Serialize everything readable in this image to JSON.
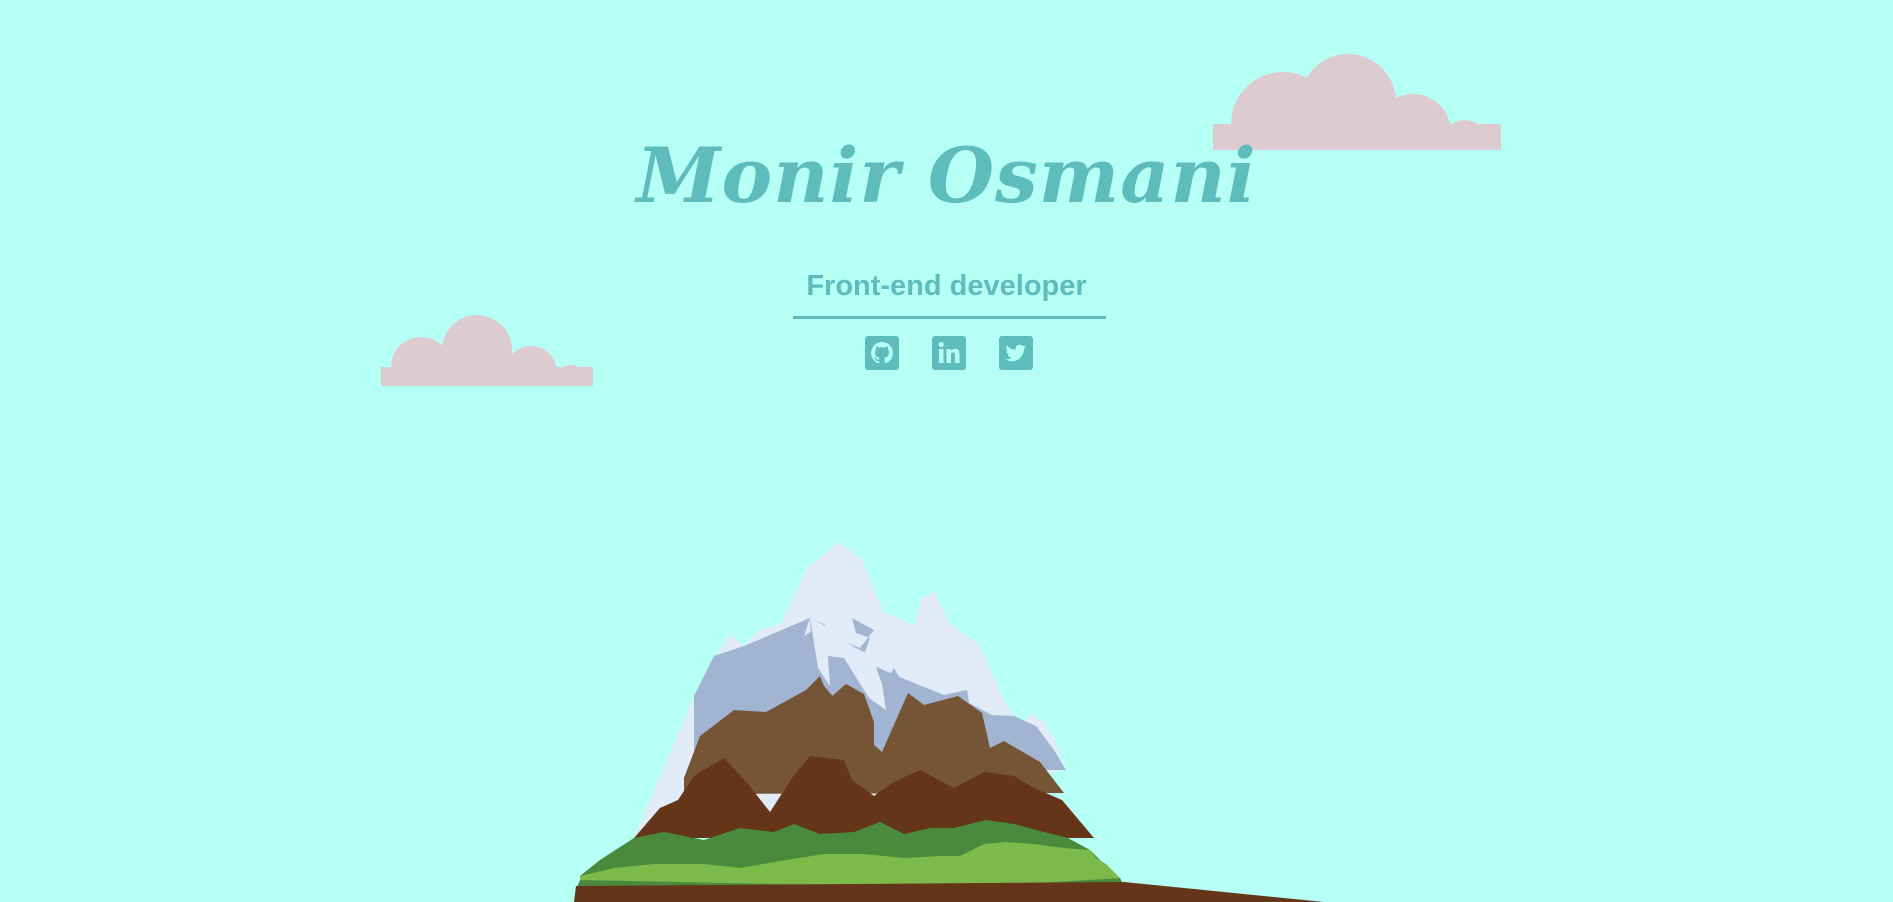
{
  "hero": {
    "name": "Monir Osmani",
    "role": "Front-end developer"
  },
  "socials": [
    {
      "icon": "github-icon",
      "label": "GitHub"
    },
    {
      "icon": "linkedin-icon",
      "label": "LinkedIn"
    },
    {
      "icon": "twitter-icon",
      "label": "Twitter"
    }
  ],
  "colors": {
    "background": "#b6fff4",
    "accent": "#5fbcbc",
    "cloud": "#dccbd1",
    "snow": "#e1ecf8",
    "snow_shadow": "#a1b4d1",
    "rock_light": "#765537",
    "rock_dark": "#643518",
    "grass_dark": "#4a8a3c",
    "grass_light": "#7dba4c",
    "soil": "#643518"
  }
}
